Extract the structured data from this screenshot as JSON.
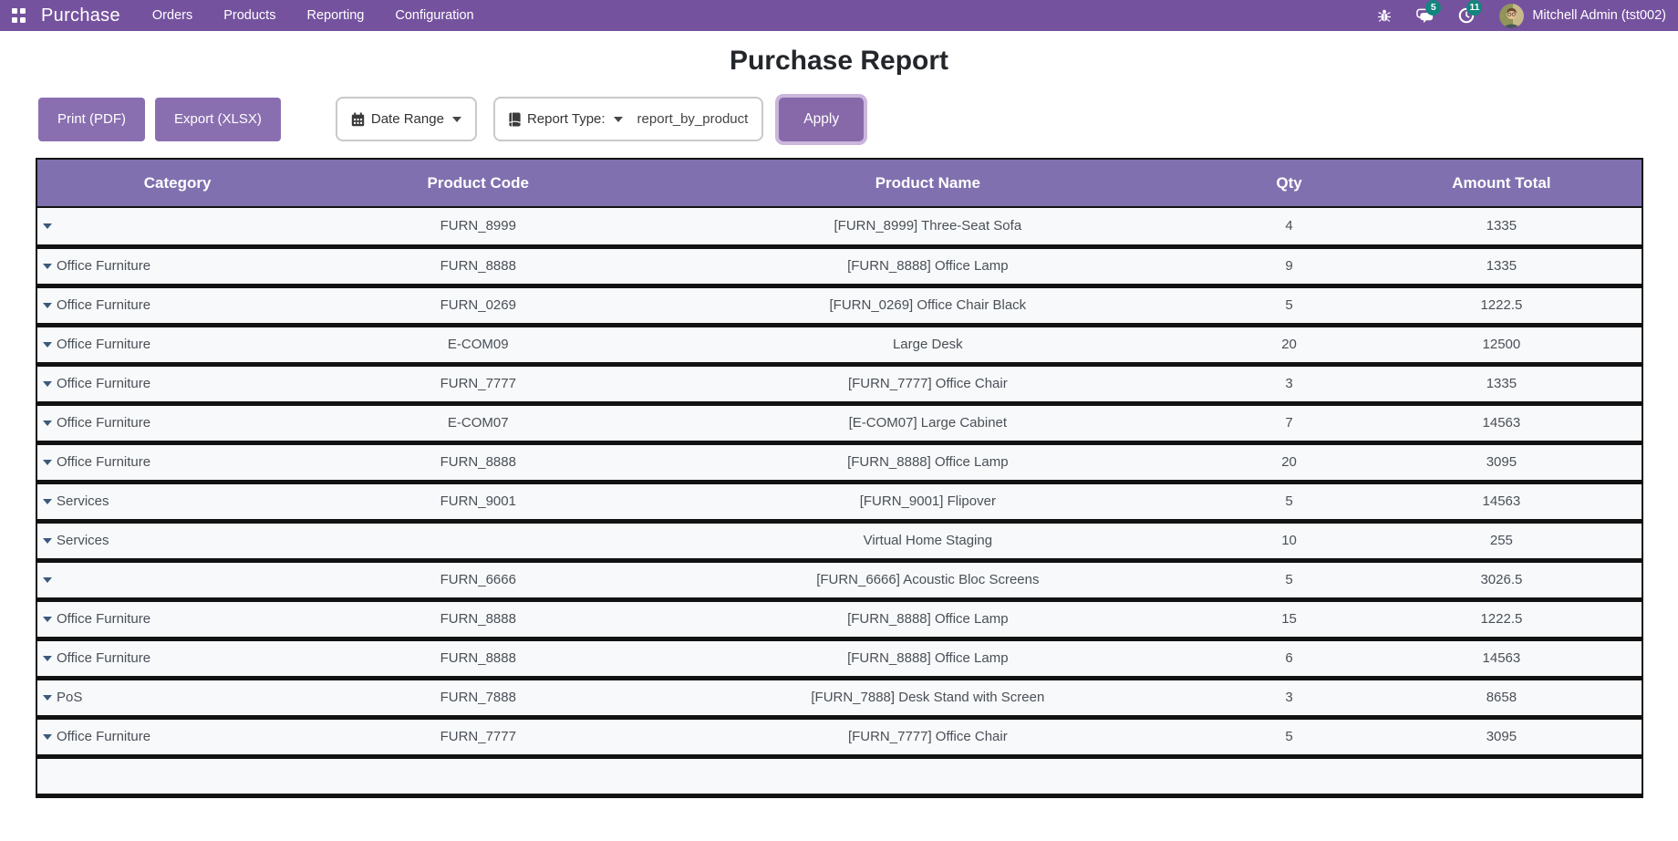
{
  "navbar": {
    "app_name": "Purchase",
    "menu_items": [
      "Orders",
      "Products",
      "Reporting",
      "Configuration"
    ],
    "messages_badge": "5",
    "activities_badge": "11",
    "user_name": "Mitchell Admin (tst002)"
  },
  "page": {
    "title": "Purchase Report"
  },
  "toolbar": {
    "print_label": "Print (PDF)",
    "export_label": "Export (XLSX)",
    "date_range_label": "Date Range",
    "report_type_label": "Report Type:",
    "report_type_value": "report_by_product",
    "apply_label": "Apply"
  },
  "colors": {
    "navbar": "#75529E",
    "table_header": "#8170AF",
    "button": "#8A6FB0",
    "badge": "#12857E",
    "apply_ring": "#CBB6DC",
    "row_bg": "#F8F9FA",
    "row_border": "#121212",
    "cell_text": "#495057",
    "caret": "#3A5A7C"
  },
  "table": {
    "columns": [
      "Category",
      "Product Code",
      "Product Name",
      "Qty",
      "Amount Total"
    ],
    "rows": [
      {
        "category": "",
        "code": "FURN_8999",
        "name": "[FURN_8999] Three-Seat Sofa",
        "qty": "4",
        "amount": "1335"
      },
      {
        "category": "Office Furniture",
        "code": "FURN_8888",
        "name": "[FURN_8888] Office Lamp",
        "qty": "9",
        "amount": "1335"
      },
      {
        "category": "Office Furniture",
        "code": "FURN_0269",
        "name": "[FURN_0269] Office Chair Black",
        "qty": "5",
        "amount": "1222.5"
      },
      {
        "category": "Office Furniture",
        "code": "E-COM09",
        "name": "Large Desk",
        "qty": "20",
        "amount": "12500"
      },
      {
        "category": "Office Furniture",
        "code": "FURN_7777",
        "name": "[FURN_7777] Office Chair",
        "qty": "3",
        "amount": "1335"
      },
      {
        "category": "Office Furniture",
        "code": "E-COM07",
        "name": "[E-COM07] Large Cabinet",
        "qty": "7",
        "amount": "14563"
      },
      {
        "category": "Office Furniture",
        "code": "FURN_8888",
        "name": "[FURN_8888] Office Lamp",
        "qty": "20",
        "amount": "3095"
      },
      {
        "category": "Services",
        "code": "FURN_9001",
        "name": "[FURN_9001] Flipover",
        "qty": "5",
        "amount": "14563"
      },
      {
        "category": "Services",
        "code": "",
        "name": "Virtual Home Staging",
        "qty": "10",
        "amount": "255"
      },
      {
        "category": "",
        "code": "FURN_6666",
        "name": "[FURN_6666] Acoustic Bloc Screens",
        "qty": "5",
        "amount": "3026.5"
      },
      {
        "category": "Office Furniture",
        "code": "FURN_8888",
        "name": "[FURN_8888] Office Lamp",
        "qty": "15",
        "amount": "1222.5"
      },
      {
        "category": "Office Furniture",
        "code": "FURN_8888",
        "name": "[FURN_8888] Office Lamp",
        "qty": "6",
        "amount": "14563"
      },
      {
        "category": "PoS",
        "code": "FURN_7888",
        "name": "[FURN_7888] Desk Stand with Screen",
        "qty": "3",
        "amount": "8658"
      },
      {
        "category": "Office Furniture",
        "code": "FURN_7777",
        "name": "[FURN_7777] Office Chair",
        "qty": "5",
        "amount": "3095"
      }
    ]
  }
}
